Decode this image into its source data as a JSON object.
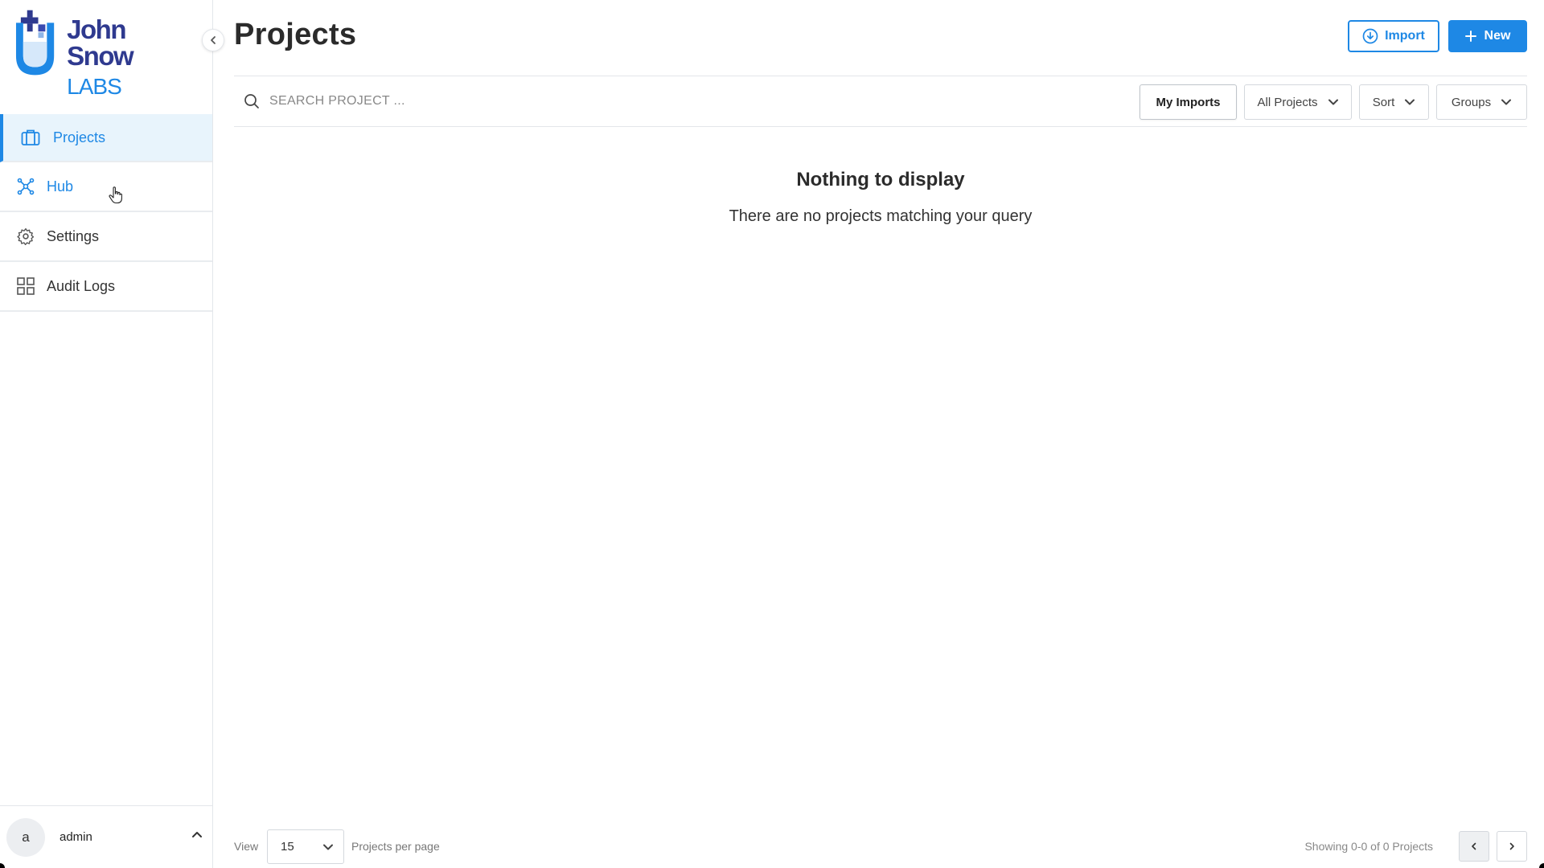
{
  "brand": {
    "line1": "John Snow",
    "line2": "LABS",
    "mark_color": "#2f3a8f",
    "accent_color": "#1e88e5"
  },
  "sidebar": {
    "items": [
      {
        "label": "Projects",
        "icon": "briefcase-icon",
        "active": true
      },
      {
        "label": "Hub",
        "icon": "hub-nodes-icon",
        "active": false
      },
      {
        "label": "Settings",
        "icon": "gear-icon",
        "active": false
      },
      {
        "label": "Audit Logs",
        "icon": "grid-icon",
        "active": false
      }
    ],
    "user": {
      "avatar_letter": "a",
      "name": "admin"
    }
  },
  "header": {
    "title": "Projects",
    "import_label": "Import",
    "new_label": "New"
  },
  "toolbar": {
    "search_placeholder": "SEARCH PROJECT ...",
    "my_imports_label": "My Imports",
    "all_projects_label": "All Projects",
    "sort_label": "Sort",
    "groups_label": "Groups"
  },
  "empty_state": {
    "title": "Nothing to display",
    "message": "There are no projects matching your query"
  },
  "footer": {
    "view_label": "View",
    "per_page_value": "15",
    "per_page_label": "Projects per page",
    "showing_text": "Showing 0-0 of 0 Projects"
  }
}
